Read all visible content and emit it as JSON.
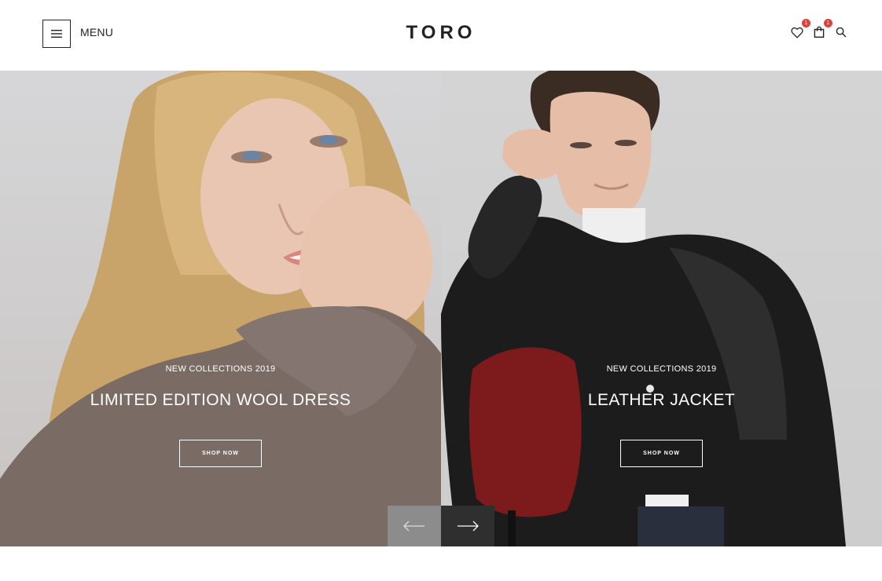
{
  "header": {
    "menu_label": "MENU",
    "logo": "TORO",
    "wishlist_count": "1",
    "cart_count": "1"
  },
  "slides": [
    {
      "kicker": "NEW COLLECTIONS 2019",
      "title": "LIMITED EDITION WOOL DRESS",
      "button": "SHOP NOW"
    },
    {
      "kicker": "NEW COLLECTIONS 2019",
      "title": "LEATHER JACKET",
      "button": "SHOP NOW"
    }
  ],
  "icons": {
    "menu": "hamburger-icon",
    "wishlist": "heart-icon",
    "cart": "shopping-bag-icon",
    "search": "search-icon",
    "prev": "arrow-left-icon",
    "next": "arrow-right-icon"
  },
  "colors": {
    "badge": "#e0413a",
    "arrow_next_bg": "#2f2f2f",
    "arrow_prev_bg": "#8c8c8c",
    "text_dark": "#222222"
  }
}
